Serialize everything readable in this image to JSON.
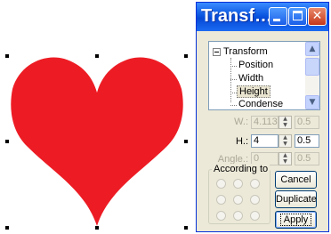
{
  "window": {
    "title": "Transf…",
    "controls": {
      "minimize_icon": "minimize-icon",
      "maximize_icon": "maximize-icon",
      "close_glyph": "✕"
    }
  },
  "tree": {
    "root": "Transform",
    "items": [
      "Position",
      "Width",
      "Height",
      "Condense"
    ],
    "selected": "Height",
    "scroll_up": "▲",
    "scroll_down": "▼"
  },
  "fields": {
    "w_label": "W.:",
    "w_value": "4.113",
    "w_step": "0.5",
    "h_label": "H.:",
    "h_value": "4",
    "h_step": "0.5",
    "angle_label": "Angle.:",
    "angle_value": "0",
    "angle_step": "0.5",
    "spin_up": "▲",
    "spin_down": "▼"
  },
  "according_to": {
    "label": "According to"
  },
  "buttons": {
    "cancel": "Cancel",
    "duplicate": "Duplicate",
    "apply": "Apply"
  },
  "shape": {
    "fill": "#ed1c24",
    "selection": "#000000"
  },
  "colors": {
    "title_bar": "#0a56e0",
    "window_bg": "#ece9d8"
  }
}
